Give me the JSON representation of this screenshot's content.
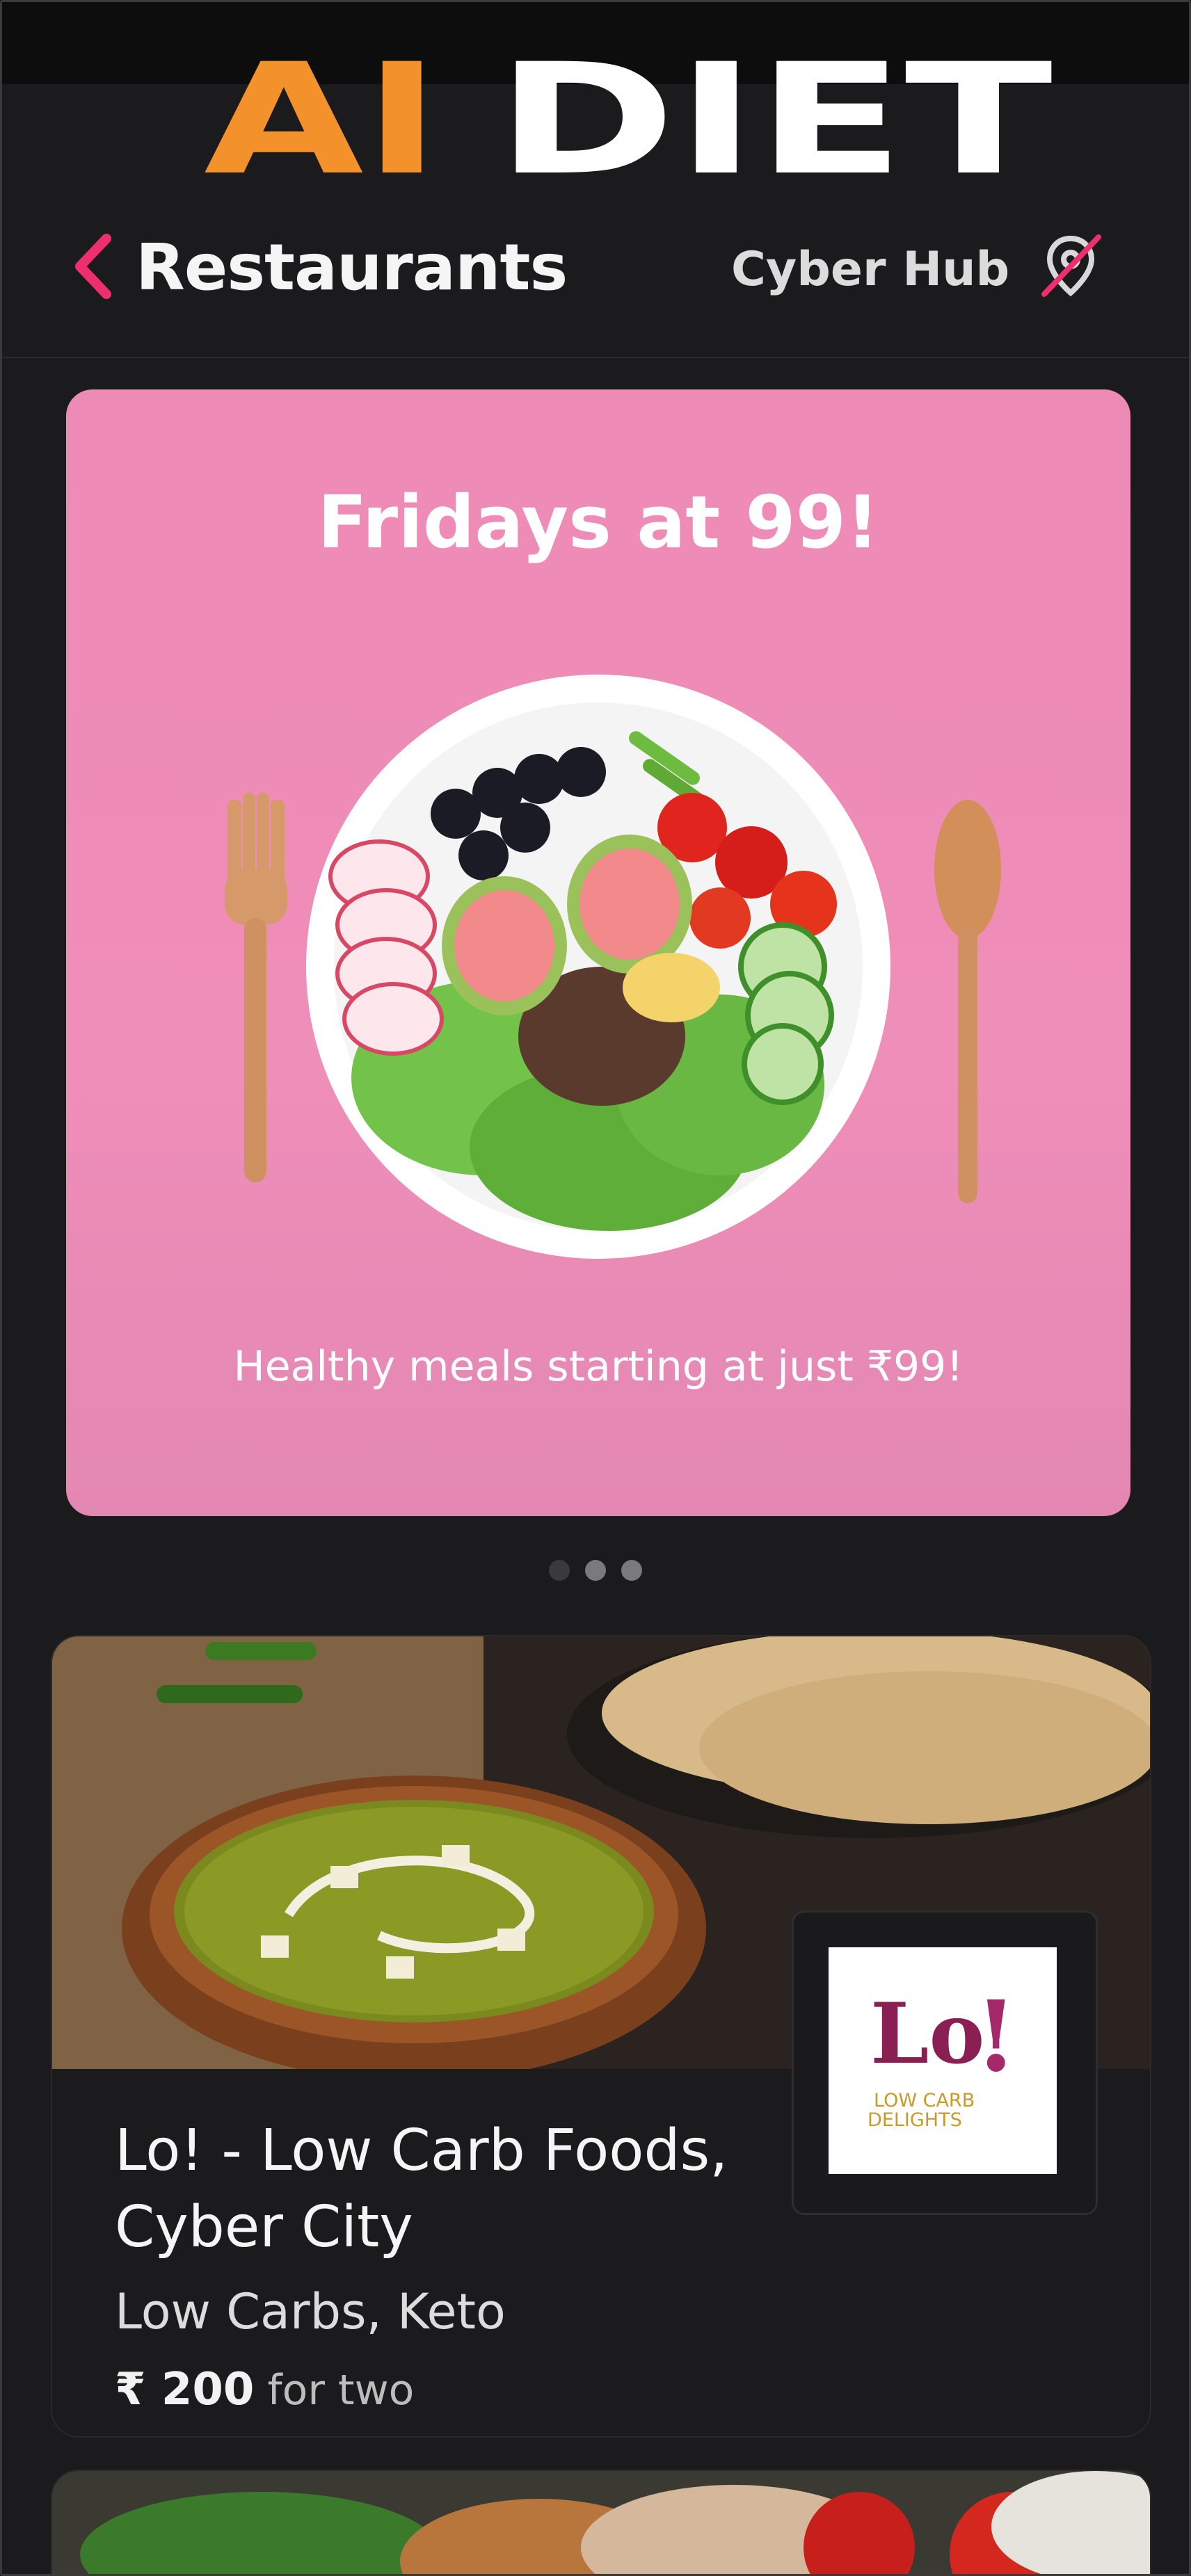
{
  "app": {
    "logo_part1": "AI",
    "logo_part2": "DIET"
  },
  "header": {
    "title": "Restaurants",
    "location": "Cyber Hub"
  },
  "banner": {
    "title": "Fridays at 99!",
    "subtitle": "Healthy meals starting at just ₹99!"
  },
  "carousel": {
    "count": 3,
    "active_index": 0
  },
  "restaurants": [
    {
      "name": "Lo! - Low Carb Foods, Cyber City",
      "cuisine": "Low Carbs, Keto",
      "price_symbol": "₹ 200",
      "price_suffix": "for two",
      "logo_text": "Lo",
      "logo_excl": "!",
      "logo_tagline1": "LOW CARB",
      "logo_tagline2": "DELIGHTS"
    }
  ],
  "colors": {
    "accent": "#ee2f6e",
    "logo_orange": "#f3922a",
    "banner_pink": "#ef8eb9",
    "background": "#1b1b1d"
  },
  "icons": {
    "back": "chevron-left-icon",
    "location": "location-off-icon"
  }
}
